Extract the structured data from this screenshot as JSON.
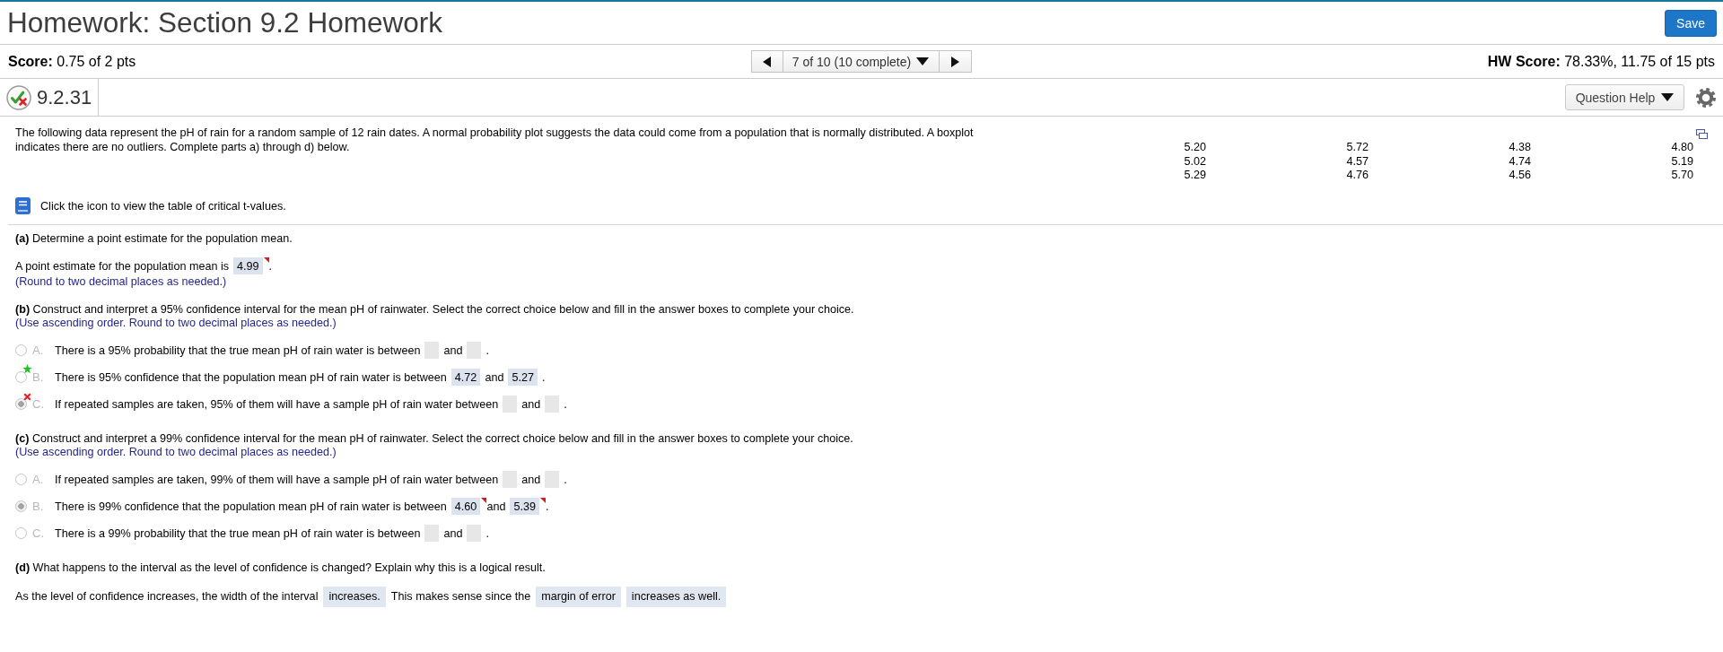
{
  "header": {
    "title": "Homework: Section 9.2 Homework",
    "save_button": "Save"
  },
  "score_bar": {
    "score": "**Score:** 0.75 of 2 pts",
    "question_selector": "7 of 10 (10 complete)",
    "hw_score": "**HW Score:** 78.33%, 11.75 of 15 pts"
  },
  "question": {
    "has_correct": true,
    "has_incorrect": true,
    "number": "9.2.31",
    "help_button": "Question Help"
  },
  "stem": {
    "text": "The following data represent the pH of rain for a random sample of 12 rain dates. A normal probability plot suggests the data could come from a population that is normally distributed. A boxplot indicates there are no outliers. Complete parts a) through d) below.",
    "data": [
      [
        "5.20",
        "5.72",
        "4.38",
        "4.80"
      ],
      [
        "5.02",
        "4.57",
        "4.74",
        "5.19"
      ],
      [
        "5.29",
        "4.76",
        "4.56",
        "5.70"
      ]
    ],
    "resource_link": "Click the icon to view the table of critical t-values."
  },
  "parts": [
    {
      "kind": "fill",
      "prompt": "**(a)** Determine a point estimate for the population mean.",
      "answer": [
        {
          "kind": "text",
          "text": "A point estimate for the population mean is"
        },
        {
          "kind": "box",
          "value": "4.99",
          "incorrect": true
        },
        {
          "kind": "text",
          "text": "."
        }
      ],
      "hint": "(Round to two decimal places as needed.)"
    },
    {
      "kind": "choice",
      "prompt": "**(b)** Construct and interpret a 95% confidence interval for the mean pH of rainwater. Select the correct choice below and fill in the answer boxes to complete your choice.",
      "hint": "(Use ascending order. Round to two decimal places as needed.)",
      "choices": [
        {
          "letter": "A.",
          "selected": false,
          "correct": false,
          "incorrect": false,
          "answer": [
            {
              "kind": "text",
              "text": "There is a 95% probability that the true mean pH of rain water is between"
            },
            {
              "kind": "box",
              "incorrect": false
            },
            {
              "kind": "text",
              "text": "and"
            },
            {
              "kind": "box",
              "incorrect": false
            },
            {
              "kind": "text",
              "text": "."
            }
          ]
        },
        {
          "letter": "B.",
          "selected": false,
          "correct": true,
          "incorrect": false,
          "answer": [
            {
              "kind": "text",
              "text": "There is 95% confidence that the population mean pH of rain water is between"
            },
            {
              "kind": "box",
              "value": "4.72",
              "incorrect": false
            },
            {
              "kind": "text",
              "text": "and"
            },
            {
              "kind": "box",
              "value": "5.27",
              "incorrect": false
            },
            {
              "kind": "text",
              "text": "."
            }
          ]
        },
        {
          "letter": "C.",
          "selected": true,
          "correct": false,
          "incorrect": true,
          "answer": [
            {
              "kind": "text",
              "text": "If repeated samples are taken, 95% of them will have a sample pH of rain water between"
            },
            {
              "kind": "box",
              "incorrect": false
            },
            {
              "kind": "text",
              "text": "and"
            },
            {
              "kind": "box",
              "incorrect": false
            },
            {
              "kind": "text",
              "text": "."
            }
          ]
        }
      ]
    },
    {
      "kind": "choice",
      "prompt": "**(c)** Construct and interpret a 99% confidence interval for the mean pH of rainwater. Select the correct choice below and fill in the answer boxes to complete your choice.",
      "hint": "(Use ascending order. Round to two decimal places as needed.)",
      "choices": [
        {
          "letter": "A.",
          "selected": false,
          "correct": false,
          "incorrect": false,
          "answer": [
            {
              "kind": "text",
              "text": "If repeated samples are taken, 99% of them will have a sample pH of rain water between"
            },
            {
              "kind": "box",
              "incorrect": false
            },
            {
              "kind": "text",
              "text": "and"
            },
            {
              "kind": "box",
              "incorrect": false
            },
            {
              "kind": "text",
              "text": "."
            }
          ]
        },
        {
          "letter": "B.",
          "selected": true,
          "correct": false,
          "incorrect": false,
          "answer": [
            {
              "kind": "text",
              "text": "There is 99% confidence that the population mean pH of rain water is between"
            },
            {
              "kind": "box",
              "value": "4.60",
              "incorrect": true
            },
            {
              "kind": "text",
              "text": "and"
            },
            {
              "kind": "box",
              "value": "5.39",
              "incorrect": true
            },
            {
              "kind": "text",
              "text": "."
            }
          ]
        },
        {
          "letter": "C.",
          "selected": false,
          "correct": false,
          "incorrect": false,
          "answer": [
            {
              "kind": "text",
              "text": "There is a 99% probability that the true mean pH of rain water is between"
            },
            {
              "kind": "box",
              "incorrect": false
            },
            {
              "kind": "text",
              "text": "and"
            },
            {
              "kind": "box",
              "incorrect": false
            },
            {
              "kind": "text",
              "text": "."
            }
          ]
        }
      ]
    },
    {
      "kind": "fill",
      "prompt": "**(d)** What happens to the interval as the level of confidence is changed? Explain why this is a logical result.",
      "answer": [
        {
          "kind": "text",
          "text": "As the level of confidence increases, the width of the interval"
        },
        {
          "kind": "menu",
          "value": "increases.",
          "incorrect": false
        },
        {
          "kind": "text",
          "text": "This makes sense since the"
        },
        {
          "kind": "menu",
          "value": "margin of error",
          "incorrect": false
        },
        {
          "kind": "menu",
          "value": "increases as well.",
          "incorrect": false
        }
      ]
    }
  ]
}
